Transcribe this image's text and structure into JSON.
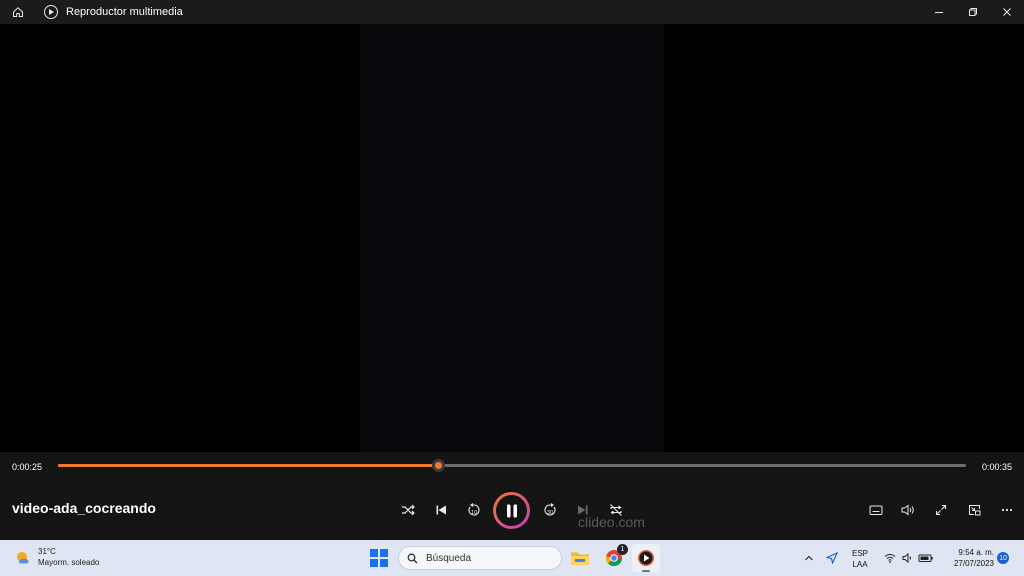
{
  "window": {
    "title": "Reproductor multimedia",
    "icons": {
      "home": "home-icon",
      "app": "media-player-icon",
      "minimize": "minimize-icon",
      "restore": "restore-icon",
      "close": "close-icon"
    }
  },
  "player": {
    "current_time": "0:00:25",
    "total_time": "0:00:35",
    "progress_fraction": 0.418,
    "media_title": "video-ada_cocreando",
    "watermark": "clideo.com",
    "state": "playing",
    "colors": {
      "accent": "#f07a2c",
      "accent_gradient_end": "#c13cc4",
      "panel": "#141414",
      "track": "#6e6e6e"
    },
    "controls": [
      "shuffle-icon",
      "previous-icon",
      "rewind-10-icon",
      "pause-icon",
      "forward-30-icon",
      "next-icon",
      "repeat-icon"
    ],
    "right_controls": [
      "captions-icon",
      "volume-icon",
      "fullscreen-icon",
      "mini-player-icon",
      "more-icon"
    ],
    "rewind_label": "10",
    "forward_label": "30"
  },
  "taskbar": {
    "weather": {
      "temp": "31°C",
      "condition": "Mayorm. soleado"
    },
    "search_placeholder": "Búsqueda",
    "chrome_badge": "1",
    "lang_top": "ESP",
    "lang_bottom": "LAA",
    "time": "9:54 a. m.",
    "date": "27/07/2023",
    "notifications": "10"
  }
}
